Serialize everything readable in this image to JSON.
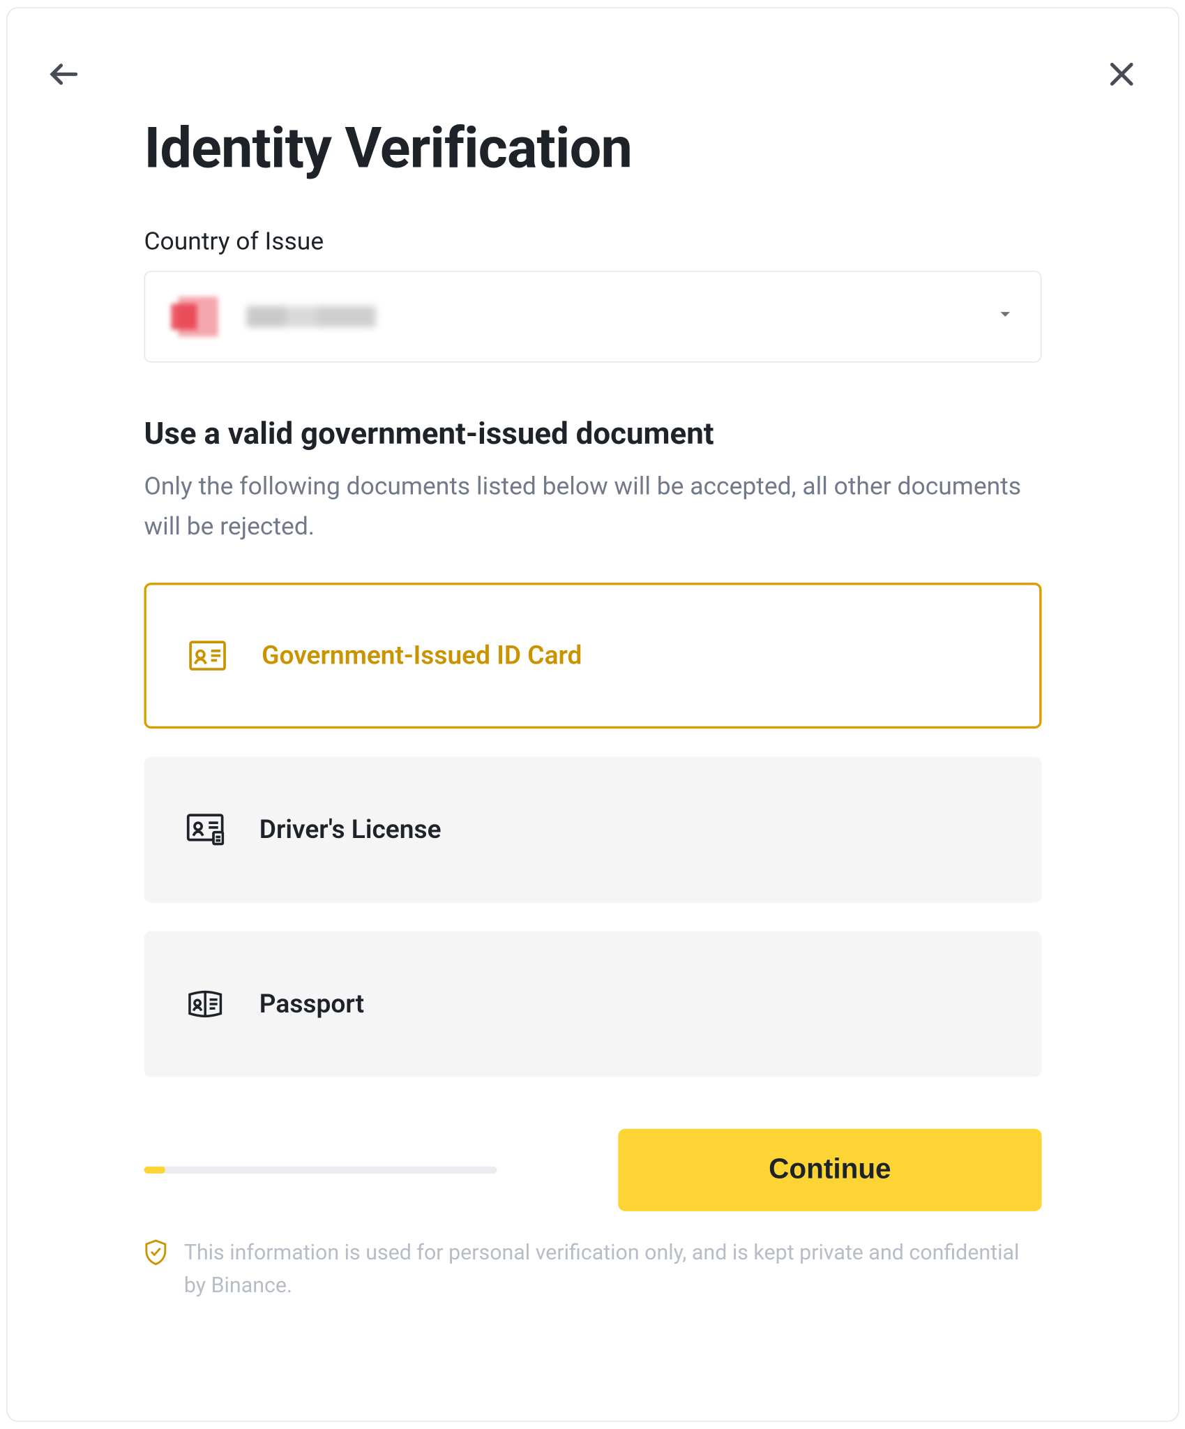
{
  "header": {
    "title": "Identity Verification"
  },
  "country": {
    "label": "Country of Issue",
    "selected_redacted": true
  },
  "doc_section": {
    "title": "Use a valid government-issued document",
    "description": "Only the following documents listed below will be accepted, all other documents will be rejected."
  },
  "options": [
    {
      "id": "gov-id",
      "label": "Government-Issued ID Card",
      "selected": true
    },
    {
      "id": "license",
      "label": "Driver's License",
      "selected": false
    },
    {
      "id": "passport",
      "label": "Passport",
      "selected": false
    }
  ],
  "progress": {
    "percent": 6
  },
  "actions": {
    "continue_label": "Continue"
  },
  "footnote": {
    "text": "This information is used for personal verification only, and is kept private and confidential by Binance."
  },
  "colors": {
    "brand_yellow": "#FCD535",
    "selected_border": "#D89F00"
  }
}
